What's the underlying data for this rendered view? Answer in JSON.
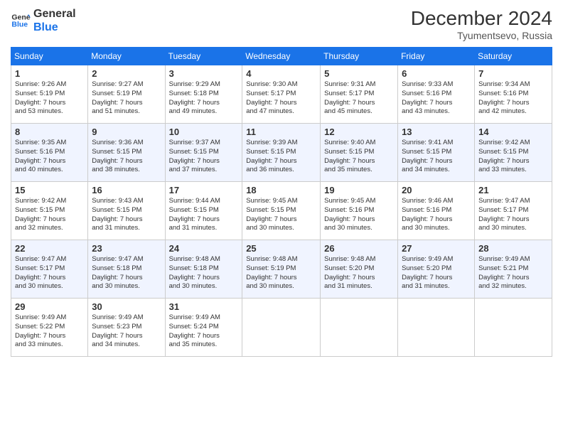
{
  "header": {
    "logo_line1": "General",
    "logo_line2": "Blue",
    "month_title": "December 2024",
    "subtitle": "Tyumentsevo, Russia"
  },
  "days_of_week": [
    "Sunday",
    "Monday",
    "Tuesday",
    "Wednesday",
    "Thursday",
    "Friday",
    "Saturday"
  ],
  "weeks": [
    [
      {
        "day": "1",
        "info": "Sunrise: 9:26 AM\nSunset: 5:19 PM\nDaylight: 7 hours\nand 53 minutes."
      },
      {
        "day": "2",
        "info": "Sunrise: 9:27 AM\nSunset: 5:19 PM\nDaylight: 7 hours\nand 51 minutes."
      },
      {
        "day": "3",
        "info": "Sunrise: 9:29 AM\nSunset: 5:18 PM\nDaylight: 7 hours\nand 49 minutes."
      },
      {
        "day": "4",
        "info": "Sunrise: 9:30 AM\nSunset: 5:17 PM\nDaylight: 7 hours\nand 47 minutes."
      },
      {
        "day": "5",
        "info": "Sunrise: 9:31 AM\nSunset: 5:17 PM\nDaylight: 7 hours\nand 45 minutes."
      },
      {
        "day": "6",
        "info": "Sunrise: 9:33 AM\nSunset: 5:16 PM\nDaylight: 7 hours\nand 43 minutes."
      },
      {
        "day": "7",
        "info": "Sunrise: 9:34 AM\nSunset: 5:16 PM\nDaylight: 7 hours\nand 42 minutes."
      }
    ],
    [
      {
        "day": "8",
        "info": "Sunrise: 9:35 AM\nSunset: 5:16 PM\nDaylight: 7 hours\nand 40 minutes."
      },
      {
        "day": "9",
        "info": "Sunrise: 9:36 AM\nSunset: 5:15 PM\nDaylight: 7 hours\nand 38 minutes."
      },
      {
        "day": "10",
        "info": "Sunrise: 9:37 AM\nSunset: 5:15 PM\nDaylight: 7 hours\nand 37 minutes."
      },
      {
        "day": "11",
        "info": "Sunrise: 9:39 AM\nSunset: 5:15 PM\nDaylight: 7 hours\nand 36 minutes."
      },
      {
        "day": "12",
        "info": "Sunrise: 9:40 AM\nSunset: 5:15 PM\nDaylight: 7 hours\nand 35 minutes."
      },
      {
        "day": "13",
        "info": "Sunrise: 9:41 AM\nSunset: 5:15 PM\nDaylight: 7 hours\nand 34 minutes."
      },
      {
        "day": "14",
        "info": "Sunrise: 9:42 AM\nSunset: 5:15 PM\nDaylight: 7 hours\nand 33 minutes."
      }
    ],
    [
      {
        "day": "15",
        "info": "Sunrise: 9:42 AM\nSunset: 5:15 PM\nDaylight: 7 hours\nand 32 minutes."
      },
      {
        "day": "16",
        "info": "Sunrise: 9:43 AM\nSunset: 5:15 PM\nDaylight: 7 hours\nand 31 minutes."
      },
      {
        "day": "17",
        "info": "Sunrise: 9:44 AM\nSunset: 5:15 PM\nDaylight: 7 hours\nand 31 minutes."
      },
      {
        "day": "18",
        "info": "Sunrise: 9:45 AM\nSunset: 5:15 PM\nDaylight: 7 hours\nand 30 minutes."
      },
      {
        "day": "19",
        "info": "Sunrise: 9:45 AM\nSunset: 5:16 PM\nDaylight: 7 hours\nand 30 minutes."
      },
      {
        "day": "20",
        "info": "Sunrise: 9:46 AM\nSunset: 5:16 PM\nDaylight: 7 hours\nand 30 minutes."
      },
      {
        "day": "21",
        "info": "Sunrise: 9:47 AM\nSunset: 5:17 PM\nDaylight: 7 hours\nand 30 minutes."
      }
    ],
    [
      {
        "day": "22",
        "info": "Sunrise: 9:47 AM\nSunset: 5:17 PM\nDaylight: 7 hours\nand 30 minutes."
      },
      {
        "day": "23",
        "info": "Sunrise: 9:47 AM\nSunset: 5:18 PM\nDaylight: 7 hours\nand 30 minutes."
      },
      {
        "day": "24",
        "info": "Sunrise: 9:48 AM\nSunset: 5:18 PM\nDaylight: 7 hours\nand 30 minutes."
      },
      {
        "day": "25",
        "info": "Sunrise: 9:48 AM\nSunset: 5:19 PM\nDaylight: 7 hours\nand 30 minutes."
      },
      {
        "day": "26",
        "info": "Sunrise: 9:48 AM\nSunset: 5:20 PM\nDaylight: 7 hours\nand 31 minutes."
      },
      {
        "day": "27",
        "info": "Sunrise: 9:49 AM\nSunset: 5:20 PM\nDaylight: 7 hours\nand 31 minutes."
      },
      {
        "day": "28",
        "info": "Sunrise: 9:49 AM\nSunset: 5:21 PM\nDaylight: 7 hours\nand 32 minutes."
      }
    ],
    [
      {
        "day": "29",
        "info": "Sunrise: 9:49 AM\nSunset: 5:22 PM\nDaylight: 7 hours\nand 33 minutes."
      },
      {
        "day": "30",
        "info": "Sunrise: 9:49 AM\nSunset: 5:23 PM\nDaylight: 7 hours\nand 34 minutes."
      },
      {
        "day": "31",
        "info": "Sunrise: 9:49 AM\nSunset: 5:24 PM\nDaylight: 7 hours\nand 35 minutes."
      },
      {
        "day": "",
        "info": ""
      },
      {
        "day": "",
        "info": ""
      },
      {
        "day": "",
        "info": ""
      },
      {
        "day": "",
        "info": ""
      }
    ]
  ]
}
